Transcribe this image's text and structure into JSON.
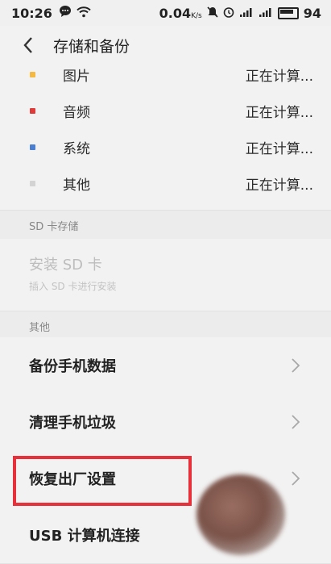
{
  "status_bar": {
    "time": "10:26",
    "network_speed": "0.04",
    "speed_unit": "K/s",
    "battery": "94"
  },
  "header": {
    "title": "存储和备份"
  },
  "storage_items": [
    {
      "name": "图片",
      "status": "正在计算...",
      "color": "#f5b942"
    },
    {
      "name": "音频",
      "status": "正在计算...",
      "color": "#e03b3b"
    },
    {
      "name": "系统",
      "status": "正在计算...",
      "color": "#4a7fd1"
    },
    {
      "name": "其他",
      "status": "正在计算...",
      "color": "#d3d3d3"
    }
  ],
  "sd_section": {
    "header": "SD 卡存储",
    "install_title": "安装 SD 卡",
    "install_subtitle": "插入 SD 卡进行安装"
  },
  "other_section": {
    "header": "其他",
    "items": [
      {
        "label": "备份手机数据"
      },
      {
        "label": "清理手机垃圾"
      },
      {
        "label": "恢复出厂设置"
      },
      {
        "label": "USB 计算机连接"
      }
    ]
  },
  "annotation_color": "#e8303a"
}
